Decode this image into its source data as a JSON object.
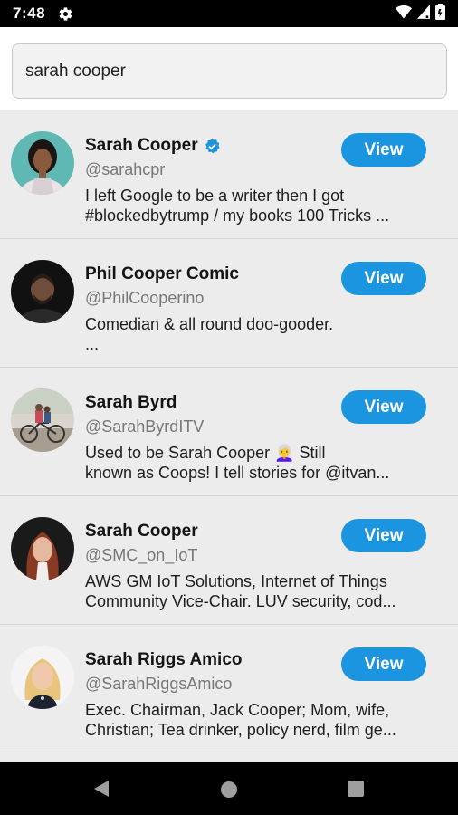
{
  "status_bar": {
    "time": "7:48",
    "icons": [
      "gear-icon",
      "wifi-icon",
      "signal-icon",
      "battery-icon"
    ]
  },
  "search": {
    "value": "sarah cooper",
    "placeholder": ""
  },
  "colors": {
    "accent": "#1b95e0",
    "list_background": "#ececec",
    "verified": "#1b95e0"
  },
  "results": [
    {
      "name": "Sarah Cooper",
      "verified": true,
      "handle": "@sarahcpr",
      "bio_line1": "I left Google to be a writer then I got",
      "bio_line2": "#blockedbytrump / my books 100 Tricks ...",
      "button": "View"
    },
    {
      "name": "Phil Cooper Comic",
      "verified": false,
      "handle": "@PhilCooperino",
      "bio_line1": "Comedian & all round doo-gooder.",
      "bio_line2": "...",
      "button": "View"
    },
    {
      "name": "Sarah Byrd",
      "verified": false,
      "handle": "@SarahByrdITV",
      "bio_line1": "Used to be Sarah Cooper 👩‍🦳 Still",
      "bio_line2": "known as Coops! I tell stories for @itvan...",
      "button": "View"
    },
    {
      "name": "Sarah Cooper",
      "verified": false,
      "handle": "@SMC_on_IoT",
      "bio_line1": "AWS GM IoT Solutions, Internet of Things",
      "bio_line2": "Community Vice-Chair. LUV security, cod...",
      "button": "View"
    },
    {
      "name": "Sarah Riggs Amico",
      "verified": false,
      "handle": "@SarahRiggsAmico",
      "bio_line1": "Exec. Chairman, Jack Cooper; Mom, wife,",
      "bio_line2": "Christian; Tea drinker, policy nerd, film ge...",
      "button": "View"
    }
  ]
}
